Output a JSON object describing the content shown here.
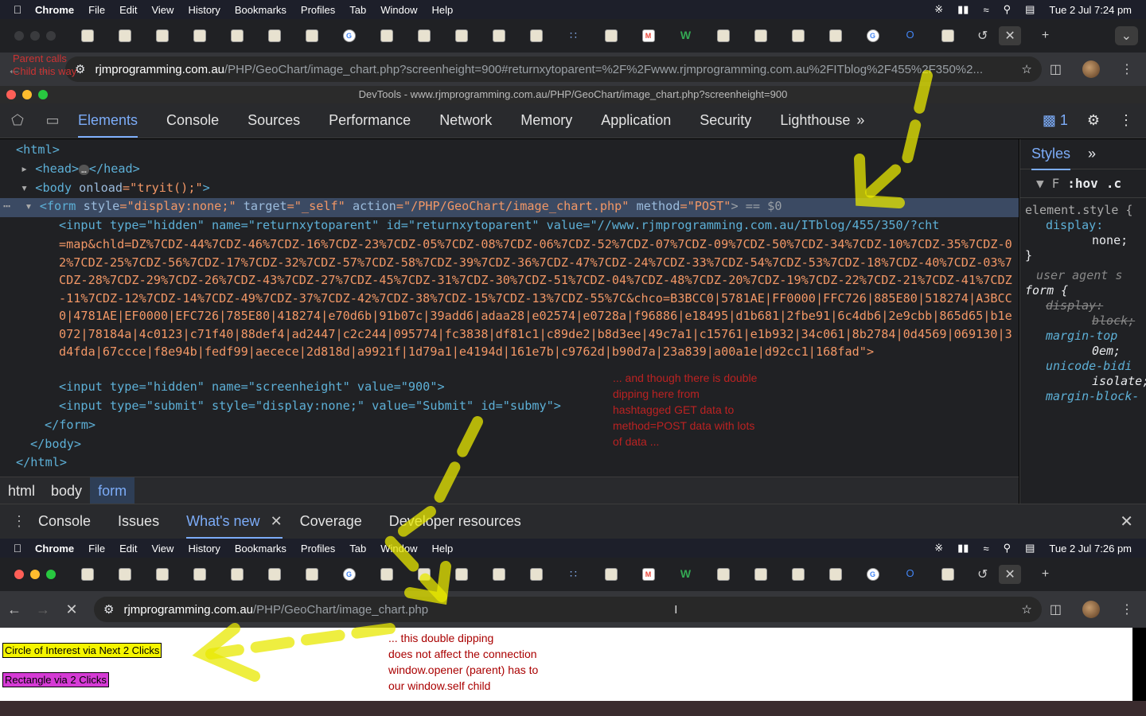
{
  "menubar_top": {
    "app": "Chrome",
    "menus": [
      "File",
      "Edit",
      "View",
      "History",
      "Bookmarks",
      "Profiles",
      "Tab",
      "Window",
      "Help"
    ],
    "datetime": "Tue 2 Jul  7:24 pm"
  },
  "menubar_bottom": {
    "app": "Chrome",
    "menus": [
      "File",
      "Edit",
      "View",
      "History",
      "Bookmarks",
      "Profiles",
      "Tab",
      "Window",
      "Help"
    ],
    "datetime": "Tue 2 Jul  7:26 pm"
  },
  "top_browser": {
    "overlay_text_1": "Parent calls",
    "overlay_text_2": "Child this way",
    "url_host": "rjmprogramming.com.au",
    "url_path": "/PHP/GeoChart/image_chart.php?screenheight=900#returnxytoparent=%2F%2Fwww.rjmprogramming.com.au%2FITblog%2F455%2F350%2..."
  },
  "devtools": {
    "title": "DevTools - www.rjmprogramming.com.au/PHP/GeoChart/image_chart.php?screenheight=900",
    "tabs": [
      "Elements",
      "Console",
      "Sources",
      "Performance",
      "Network",
      "Memory",
      "Application",
      "Security",
      "Lighthouse"
    ],
    "active_tab": "Elements",
    "issues_count": "1",
    "dom": {
      "html_open": "<html>",
      "head_open": "<head>",
      "head_close": "</head>",
      "body_tag": "<body",
      "body_attr": " onload",
      "body_val": "=\"tryit();\"",
      "body_end": ">",
      "form_tag": "<form",
      "form_a1": " style",
      "form_v1": "=\"display:none;\"",
      "form_a2": " target",
      "form_v2": "=\"_self\"",
      "form_a3": " action",
      "form_v3": "=\"/PHP/GeoChart/image_chart.php\"",
      "form_a4": " method",
      "form_v4": "=\"POST\"",
      "form_end": "> == $0",
      "input1_prefix": "<input type=\"hidden\" name=\"returnxytoparent\" id=\"returnxytoparent\" value=\"//www.rjmprogramming.com.au/ITblog/455/350/?cht",
      "input1_value": "=map&chld=DZ%7CDZ-44%7CDZ-46%7CDZ-16%7CDZ-23%7CDZ-05%7CDZ-08%7CDZ-06%7CDZ-52%7CDZ-07%7CDZ-09%7CDZ-50%7CDZ-34%7CDZ-10%7CDZ-35%7CDZ-02%7CDZ-25%7CDZ-56%7CDZ-17%7CDZ-32%7CDZ-57%7CDZ-58%7CDZ-39%7CDZ-36%7CDZ-47%7CDZ-24%7CDZ-33%7CDZ-54%7CDZ-53%7CDZ-18%7CDZ-40%7CDZ-03%7CDZ-28%7CDZ-29%7CDZ-26%7CDZ-43%7CDZ-27%7CDZ-45%7CDZ-31%7CDZ-30%7CDZ-51%7CDZ-04%7CDZ-48%7CDZ-20%7CDZ-19%7CDZ-22%7CDZ-21%7CDZ-41%7CDZ-11%7CDZ-12%7CDZ-14%7CDZ-49%7CDZ-37%7CDZ-42%7CDZ-38%7CDZ-15%7CDZ-13%7CDZ-55%7C&chco=B3BCC0|5781AE|FF0000|FFC726|885E80|518274|A3BCC0|4781AE|EF0000|EFC726|785E80|418274|e70d6b|91b07c|39add6|adaa28|e02574|e0728a|f96886|e18495|d1b681|2fbe91|6c4db6|2e9cbb|865d65|b1e072|78184a|4c0123|c71f40|88def4|ad2447|c2c244|095774|fc3838|df81c1|c89de2|b8d3ee|49c7a1|c15761|e1b932|34c061|8b2784|0d4569|069130|3d4fda|67ccce|f8e94b|fedf99|aecece|2d818d|a9921f|1d79a1|e4194d|161e7b|c9762d|b90d7a|23a839|a00a1e|d92cc1|168fad\">",
      "input2": "<input type=\"hidden\" name=\"screenheight\" value=\"900\">",
      "input3": "<input type=\"submit\" style=\"display:none;\" value=\"Submit\" id=\"submy\">",
      "form_close": "</form>",
      "body_close": "</body>",
      "html_close": "</html>"
    },
    "annotation_1": "... and though there is double dipping here from hashtagged GET data to method=POST data with lots of data ...",
    "breadcrumbs": [
      "html",
      "body",
      "form"
    ],
    "styles": {
      "tabs": [
        "Styles"
      ],
      "filter": "F",
      "hov": ":hov",
      "cls": ".c",
      "rule1_selector": "element.style {",
      "rule1_prop": "display:",
      "rule1_val": "none;",
      "rule1_close": "}",
      "ua_label": "user agent s",
      "ua_selector": "form {",
      "ua_p1": "display:",
      "ua_v1": "block;",
      "ua_p2": "margin-top",
      "ua_v2": "0em;",
      "ua_p3": "unicode-bidi",
      "ua_v3": "isolate;",
      "ua_p4": "margin-block-"
    },
    "drawer_tabs": [
      "Console",
      "Issues",
      "What's new",
      "Coverage",
      "Developer resources"
    ],
    "drawer_active": "What's new"
  },
  "bottom_browser": {
    "url_host": "rjmprogramming.com.au",
    "url_path": "/PHP/GeoChart/image_chart.php",
    "button_circle": "Circle of Interest via Next 2 Clicks",
    "button_rect": "Rectangle via 2 Clicks",
    "annotation_2_line1": "... this double dipping",
    "annotation_2_line2": "does not affect the connection",
    "annotation_2_line3": "window.opener (parent) has to",
    "annotation_2_line4": "our window.self child"
  },
  "colors": {
    "arrow": "#e8e800",
    "annotation": "#b22222",
    "selected_line": "#3b4a63"
  }
}
